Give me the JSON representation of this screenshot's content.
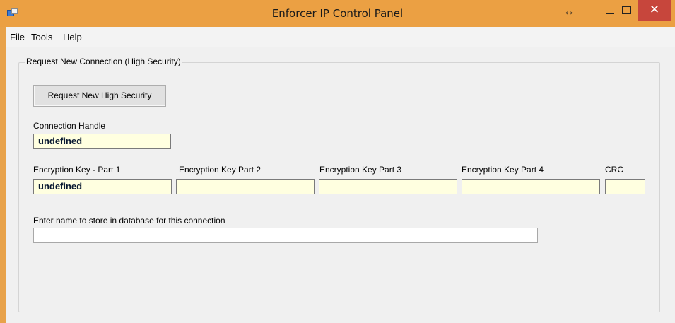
{
  "window": {
    "title": "Enforcer IP Control Panel",
    "resize_symbol": "↔",
    "close_symbol": "✕"
  },
  "menu": {
    "items": [
      "File",
      "Tools",
      "Help"
    ]
  },
  "group": {
    "label": "Request New Connection (High Security)",
    "request_button_label": "Request New High Security",
    "connection_handle_label": "Connection Handle",
    "connection_handle_value": "undefined",
    "key_labels": [
      "Encryption Key - Part 1",
      "Encryption Key Part 2",
      "Encryption Key Part 3",
      "Encryption Key Part 4",
      "CRC"
    ],
    "key_values": [
      "undefined",
      "",
      "",
      "",
      ""
    ],
    "name_label": "Enter name to store in database for this connection",
    "name_value": ""
  }
}
